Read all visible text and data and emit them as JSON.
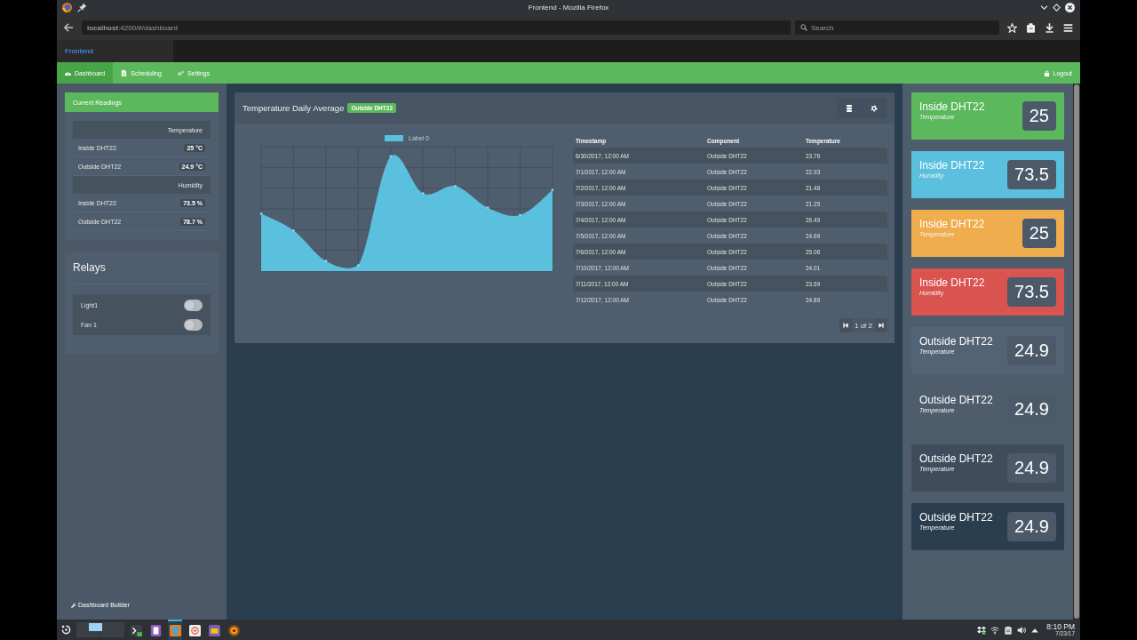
{
  "window": {
    "title": "Frontend - Mozilla Firefox"
  },
  "browser": {
    "url": "**localhost**:4200/#/dashboard",
    "search": {
      "placeholder": "Search"
    },
    "tabs": [
      {
        "label": "Frontend",
        "selected": true
      }
    ]
  },
  "navbar": {
    "items": [
      {
        "label": "Dashboard",
        "selected": true
      },
      {
        "label": "Scheduling",
        "selected": false
      },
      {
        "label": "Settings",
        "selected": false
      }
    ],
    "logout": "Logout"
  },
  "current_readings": {
    "title": "Current Readings",
    "groups": [
      {
        "heading": "Temperature",
        "rows": [
          {
            "name": "Inside DHT22",
            "value": "25 °C"
          },
          {
            "name": "Outside DHT22",
            "value": "24.9 °C"
          }
        ]
      },
      {
        "heading": "Humidity",
        "rows": [
          {
            "name": "Inside DHT22",
            "value": "73.5 %"
          },
          {
            "name": "Outside DHT22",
            "value": "78.7 %"
          }
        ]
      }
    ]
  },
  "relays": {
    "title": "Relays",
    "items": [
      {
        "label": "Light1",
        "on": false
      },
      {
        "label": "Fan 1",
        "on": false
      }
    ]
  },
  "sidebar_link": "Dashboard Builder",
  "chart_card": {
    "title": "Temperature Daily Average",
    "badge": "Outside DHT22",
    "chart": {
      "legend_label": "Label 0"
    },
    "table": {
      "columns": [
        "Timestamp",
        "Component",
        "Temperature"
      ],
      "rows": [
        [
          "6/30/2017, 12:00 AM",
          "Outside DHT22",
          "23.76"
        ],
        [
          "7/1/2017, 12:00 AM",
          "Outside DHT22",
          "22.93"
        ],
        [
          "7/2/2017, 12:00 AM",
          "Outside DHT22",
          "21.48"
        ],
        [
          "7/3/2017, 12:00 AM",
          "Outside DHT22",
          "21.25"
        ],
        [
          "7/4/2017, 12:00 AM",
          "Outside DHT22",
          "26.49"
        ],
        [
          "7/5/2017, 12:00 AM",
          "Outside DHT22",
          "24.69"
        ],
        [
          "7/6/2017, 12:00 AM",
          "Outside DHT22",
          "25.06"
        ],
        [
          "7/10/2017, 12:00 AM",
          "Outside DHT22",
          "24.01"
        ],
        [
          "7/11/2017, 12:00 AM",
          "Outside DHT22",
          "23.69"
        ],
        [
          "7/12/2017, 12:00 AM",
          "Outside DHT22",
          "24.89"
        ]
      ]
    },
    "pagination": "1 of 2"
  },
  "tiles": [
    {
      "title": "Inside DHT22",
      "subtitle": "Temperature",
      "value": "25",
      "color": "#5cb85c"
    },
    {
      "title": "Inside DHT22",
      "subtitle": "Humidity",
      "value": "73.5",
      "color": "#5bc0de"
    },
    {
      "title": "Inside DHT22",
      "subtitle": "Temperature",
      "value": "25",
      "color": "#f0ad4e"
    },
    {
      "title": "Inside DHT22",
      "subtitle": "Humidity",
      "value": "73.5",
      "color": "#d9534f"
    },
    {
      "title": "Outside DHT22",
      "subtitle": "Temperature",
      "value": "24.9",
      "color": "#536376"
    },
    {
      "title": "Outside DHT22",
      "subtitle": "Temperature",
      "value": "24.9",
      "color": "#4e5d6c"
    },
    {
      "title": "Outside DHT22",
      "subtitle": "Temperature",
      "value": "24.9",
      "color": "#3f4c5c"
    },
    {
      "title": "Outside DHT22",
      "subtitle": "Temperature",
      "value": "24.9",
      "color": "#2b3e50"
    }
  ],
  "taskbar": {
    "tasks": [
      {
        "active": false
      },
      {
        "active": false
      },
      {
        "active": true
      },
      {
        "active": false
      },
      {
        "active": false
      },
      {
        "active": false
      }
    ],
    "clock": {
      "time": "8:10 PM",
      "date": "7/23/17"
    }
  }
}
